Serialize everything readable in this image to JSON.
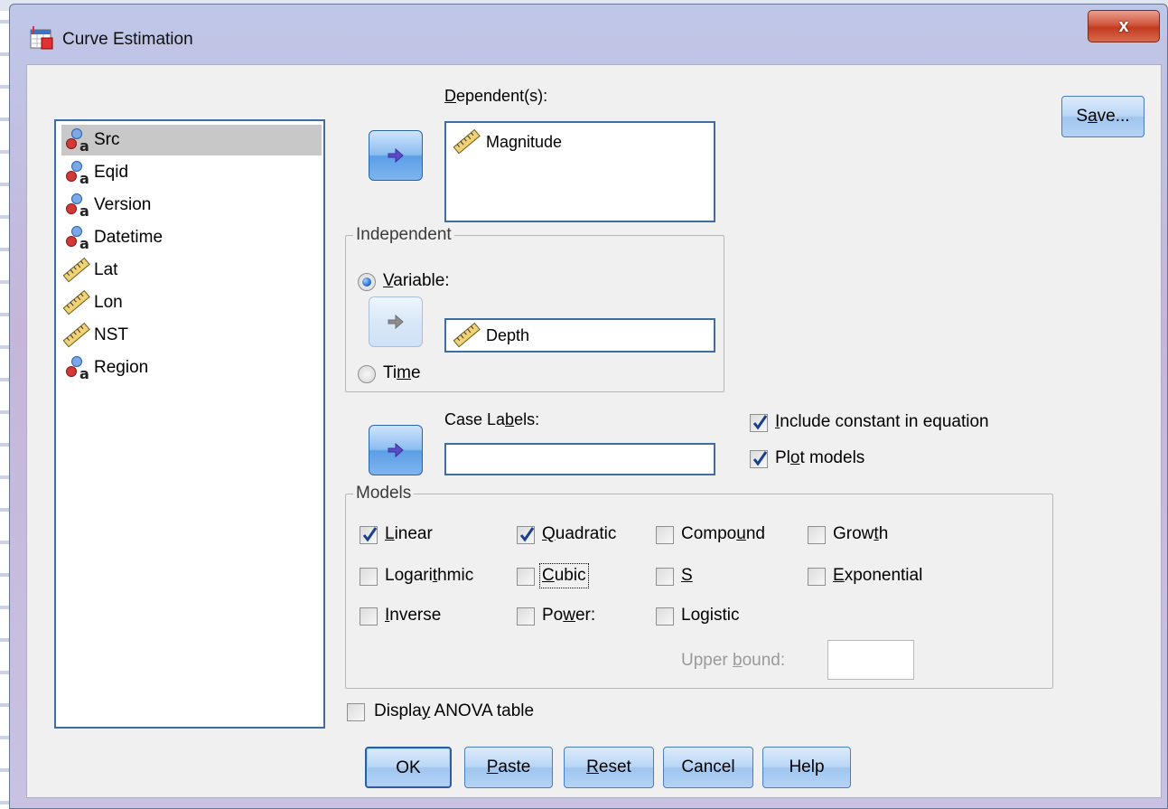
{
  "window": {
    "title": "Curve Estimation",
    "close_label": "x"
  },
  "variables": [
    {
      "label": "Src",
      "icon": "nominal-string-icon",
      "selected": true
    },
    {
      "label": "Eqid",
      "icon": "nominal-string-icon"
    },
    {
      "label": "Version",
      "icon": "nominal-string-icon"
    },
    {
      "label": "Datetime",
      "icon": "nominal-string-icon"
    },
    {
      "label": "Lat",
      "icon": "scale-ruler-icon"
    },
    {
      "label": "Lon",
      "icon": "scale-ruler-icon"
    },
    {
      "label": "NST",
      "icon": "scale-ruler-icon"
    },
    {
      "label": "Region",
      "icon": "nominal-string-icon"
    }
  ],
  "dependent": {
    "label_pre": "",
    "label_ul": "D",
    "label_post": "ependent(s):",
    "value": "Magnitude",
    "value_icon": "scale-ruler-icon"
  },
  "independent": {
    "legend": "Independent",
    "variable_ul": "V",
    "variable_post": "ariable:",
    "variable_selected": true,
    "value": "Depth",
    "value_icon": "scale-ruler-icon",
    "time_pre": "Ti",
    "time_ul": "m",
    "time_post": "e"
  },
  "case_labels": {
    "pre": "Case La",
    "ul": "b",
    "post": "els:",
    "value": ""
  },
  "options": {
    "include_constant": {
      "pre": "",
      "ul": "I",
      "post": "nclude constant in equation",
      "checked": true
    },
    "plot_models": {
      "pre": "Pl",
      "ul": "o",
      "post": "t models",
      "checked": true
    }
  },
  "models": {
    "legend": "Models",
    "linear": {
      "pre": "",
      "ul": "L",
      "post": "inear",
      "checked": true
    },
    "quadratic": {
      "pre": "",
      "ul": "Q",
      "post": "uadratic",
      "checked": true
    },
    "compound": {
      "pre": "Compo",
      "ul": "u",
      "post": "nd",
      "checked": false
    },
    "growth": {
      "pre": "Grow",
      "ul": "t",
      "post": "h",
      "checked": false
    },
    "logarithmic": {
      "pre": "Logari",
      "ul": "t",
      "post": "hmic",
      "checked": false
    },
    "cubic": {
      "pre": "",
      "ul": "C",
      "post": "ubic",
      "checked": false
    },
    "s": {
      "pre": "",
      "ul": "S",
      "post": "",
      "checked": false
    },
    "exponential": {
      "pre": "",
      "ul": "E",
      "post": "xponential",
      "checked": false
    },
    "inverse": {
      "pre": "",
      "ul": "I",
      "post": "nverse",
      "checked": false
    },
    "power": {
      "pre": "Po",
      "ul": "w",
      "post": "er:",
      "checked": false
    },
    "logistic": {
      "pre": "Lo",
      "ul": "g",
      "post": "istic",
      "checked": false
    },
    "upper_bound": {
      "pre": "Upper ",
      "ul": "b",
      "post": "ound:",
      "value": ""
    }
  },
  "anova": {
    "pre": "Displa",
    "ul": "y",
    "post": " ANOVA table",
    "checked": false
  },
  "buttons": {
    "save": {
      "pre": "S",
      "ul": "a",
      "post": "ve..."
    },
    "ok": "OK",
    "paste": {
      "pre": "",
      "ul": "P",
      "post": "aste"
    },
    "reset": {
      "pre": "",
      "ul": "R",
      "post": "eset"
    },
    "cancel": "Cancel",
    "help": "Help"
  },
  "colors": {
    "accent": "#2d6fd0",
    "title_gradient": "#c5b6d9",
    "close_red": "#c23b21"
  }
}
